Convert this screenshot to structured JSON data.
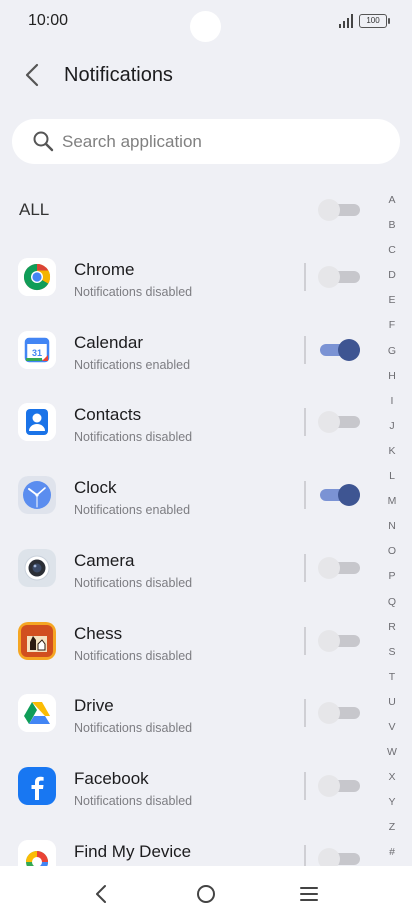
{
  "status_bar": {
    "time": "10:00",
    "battery": "100",
    "icons": [
      "signal-icon",
      "battery-icon"
    ]
  },
  "header": {
    "title": "Notifications",
    "back_icon": "chevron-left-icon"
  },
  "search": {
    "placeholder": "Search application",
    "value": ""
  },
  "all": {
    "label": "ALL",
    "enabled": false
  },
  "apps": [
    {
      "name": "Chrome",
      "status": "Notifications disabled",
      "enabled": false,
      "icon": "chrome-icon"
    },
    {
      "name": "Calendar",
      "status": "Notifications enabled",
      "enabled": true,
      "icon": "calendar-icon",
      "icon_text": "31"
    },
    {
      "name": "Contacts",
      "status": "Notifications disabled",
      "enabled": false,
      "icon": "contacts-icon"
    },
    {
      "name": "Clock",
      "status": "Notifications enabled",
      "enabled": true,
      "icon": "clock-icon"
    },
    {
      "name": "Camera",
      "status": "Notifications disabled",
      "enabled": false,
      "icon": "camera-icon"
    },
    {
      "name": "Chess",
      "status": "Notifications disabled",
      "enabled": false,
      "icon": "chess-icon"
    },
    {
      "name": "Drive",
      "status": "Notifications disabled",
      "enabled": false,
      "icon": "drive-icon"
    },
    {
      "name": "Facebook",
      "status": "Notifications disabled",
      "enabled": false,
      "icon": "facebook-icon"
    },
    {
      "name": "Find My Device",
      "status": "",
      "enabled": false,
      "icon": "find-my-device-icon"
    }
  ],
  "alpha_index": [
    "A",
    "B",
    "C",
    "D",
    "E",
    "F",
    "G",
    "H",
    "I",
    "J",
    "K",
    "L",
    "M",
    "N",
    "O",
    "P",
    "Q",
    "R",
    "S",
    "T",
    "U",
    "V",
    "W",
    "X",
    "Y",
    "Z",
    "#"
  ],
  "nav_bar": {
    "buttons": [
      "back-icon",
      "home-icon",
      "menu-icon"
    ]
  },
  "colors": {
    "background": "#eff0f5",
    "toggle_on_track": "#7b93d4",
    "toggle_on_knob": "#3e5592",
    "toggle_off_track": "#c7c7cc",
    "toggle_off_knob": "#e6e6e9"
  }
}
